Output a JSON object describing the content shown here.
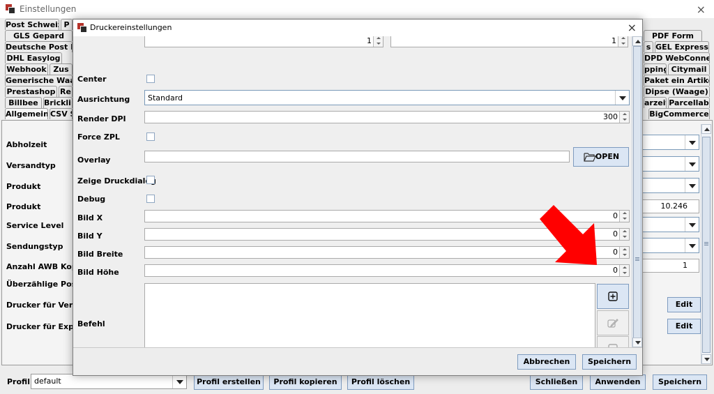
{
  "background_window": {
    "title": "Einstellungen",
    "close_glyph": "×",
    "tab_rows": [
      [
        "Post Schweiz",
        "P"
      ],
      [
        "GLS Gepard",
        "PDF Form"
      ],
      [
        "Deutsche Post DV",
        "s",
        "GEL Express"
      ],
      [
        "DHL Easylog",
        "DPD WebConnect"
      ],
      [
        "Webhook",
        "Zus",
        "pping",
        "Citymail"
      ],
      [
        "Generische Waage",
        "Paket ein Artikel"
      ],
      [
        "Prestashop",
        "Re",
        "Dipse (Waage)"
      ],
      [
        "Billbee",
        "Bricklin",
        "arzeit",
        "Parcellab"
      ],
      [
        "Allgemein",
        "CSV S",
        "BigCommerce"
      ]
    ],
    "field_labels": [
      "Abholzeit",
      "Versandtyp",
      "Produkt",
      "Produkt",
      "Service Level",
      "Sendungstyp",
      "Anzahl AWB Kopien",
      "Überzählige Positio",
      "Drucker für Versand",
      "Drucker für Exportdo"
    ],
    "produkt_value": "10.246",
    "awb_value": "1",
    "edit_label": "Edit",
    "bottom": {
      "profil_label": "Profil",
      "profil_value": "default",
      "profil_erstellen": "Profil erstellen",
      "profil_kopieren": "Profil kopieren",
      "profil_loeschen": "Profil löschen",
      "schliessen": "Schließen",
      "anwenden": "Anwenden",
      "speichern": "Speichern"
    }
  },
  "dialog": {
    "title": "Druckereinstellungen",
    "close_glyph": "×",
    "top_spinner_values": [
      "1",
      "1"
    ],
    "fields": {
      "center_label": "Center",
      "ausrichtung_label": "Ausrichtung",
      "ausrichtung_value": "Standard",
      "render_dpi_label": "Render DPI",
      "render_dpi_value": "300",
      "force_zpl_label": "Force ZPL",
      "overlay_label": "Overlay",
      "overlay_value": "",
      "open_button": "OPEN",
      "zeige_druckdialog_label": "Zeige Druckdialog",
      "debug_label": "Debug",
      "bild_x_label": "Bild X",
      "bild_x_value": "0",
      "bild_y_label": "Bild Y",
      "bild_y_value": "0",
      "bild_breite_label": "Bild Breite",
      "bild_breite_value": "0",
      "bild_hoehe_label": "Bild Höhe",
      "bild_hoehe_value": "0",
      "befehl_label": "Befehl",
      "befehl_value": ""
    },
    "buttons": {
      "abbrechen": "Abbrechen",
      "speichern": "Speichern"
    }
  },
  "colors": {
    "annotation_arrow": "#ff0000",
    "button_blue": "#dbe6f4"
  },
  "icons": [
    "app-icon",
    "folder-open-icon",
    "plus-square-icon",
    "edit-pencil-icon",
    "minus-square-icon",
    "close-icon",
    "dropdown-arrow-icon"
  ]
}
